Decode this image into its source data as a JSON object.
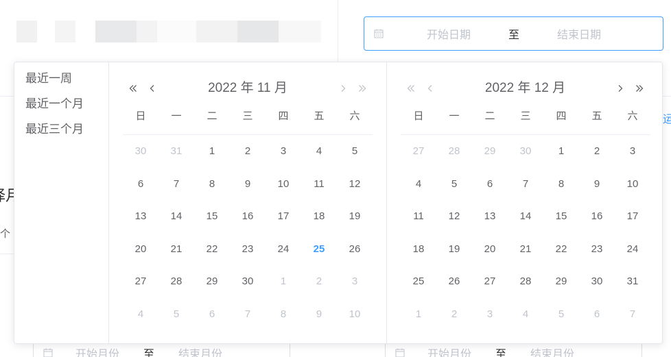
{
  "background": {
    "fragment_title": "择月",
    "fragment_text": "个",
    "fragment_link": "运"
  },
  "top_range": {
    "start_placeholder": "开始日期",
    "separator": "至",
    "end_placeholder": "结束日期"
  },
  "bottom_range_left": {
    "start_placeholder": "开始月份",
    "separator": "至",
    "end_placeholder": "结束月份"
  },
  "bottom_range_right": {
    "start_placeholder": "开始月份",
    "separator": "至",
    "end_placeholder": "结束月份"
  },
  "shortcuts": [
    "最近一周",
    "最近一个月",
    "最近三个月"
  ],
  "weekdays": [
    "日",
    "一",
    "二",
    "三",
    "四",
    "五",
    "六"
  ],
  "months": [
    {
      "title": "2022 年 11 月",
      "days": [
        {
          "d": "30",
          "o": true
        },
        {
          "d": "31",
          "o": true
        },
        {
          "d": "1"
        },
        {
          "d": "2"
        },
        {
          "d": "3"
        },
        {
          "d": "4"
        },
        {
          "d": "5"
        },
        {
          "d": "6"
        },
        {
          "d": "7"
        },
        {
          "d": "8"
        },
        {
          "d": "9"
        },
        {
          "d": "10"
        },
        {
          "d": "11"
        },
        {
          "d": "12"
        },
        {
          "d": "13"
        },
        {
          "d": "14"
        },
        {
          "d": "15"
        },
        {
          "d": "16"
        },
        {
          "d": "17"
        },
        {
          "d": "18"
        },
        {
          "d": "19"
        },
        {
          "d": "20"
        },
        {
          "d": "21"
        },
        {
          "d": "22"
        },
        {
          "d": "23"
        },
        {
          "d": "24"
        },
        {
          "d": "25",
          "t": true
        },
        {
          "d": "26"
        },
        {
          "d": "27"
        },
        {
          "d": "28"
        },
        {
          "d": "29"
        },
        {
          "d": "30"
        },
        {
          "d": "1",
          "o": true
        },
        {
          "d": "2",
          "o": true
        },
        {
          "d": "3",
          "o": true
        },
        {
          "d": "4",
          "o": true
        },
        {
          "d": "5",
          "o": true
        },
        {
          "d": "6",
          "o": true
        },
        {
          "d": "7",
          "o": true
        },
        {
          "d": "8",
          "o": true
        },
        {
          "d": "9",
          "o": true
        },
        {
          "d": "10",
          "o": true
        }
      ]
    },
    {
      "title": "2022 年 12 月",
      "days": [
        {
          "d": "27",
          "o": true
        },
        {
          "d": "28",
          "o": true
        },
        {
          "d": "29",
          "o": true
        },
        {
          "d": "30",
          "o": true
        },
        {
          "d": "1"
        },
        {
          "d": "2"
        },
        {
          "d": "3"
        },
        {
          "d": "4"
        },
        {
          "d": "5"
        },
        {
          "d": "6"
        },
        {
          "d": "7"
        },
        {
          "d": "8"
        },
        {
          "d": "9"
        },
        {
          "d": "10"
        },
        {
          "d": "11"
        },
        {
          "d": "12"
        },
        {
          "d": "13"
        },
        {
          "d": "14"
        },
        {
          "d": "15"
        },
        {
          "d": "16"
        },
        {
          "d": "17"
        },
        {
          "d": "18"
        },
        {
          "d": "19"
        },
        {
          "d": "20"
        },
        {
          "d": "21"
        },
        {
          "d": "22"
        },
        {
          "d": "23"
        },
        {
          "d": "24"
        },
        {
          "d": "25"
        },
        {
          "d": "26"
        },
        {
          "d": "27"
        },
        {
          "d": "28"
        },
        {
          "d": "29"
        },
        {
          "d": "30"
        },
        {
          "d": "31"
        },
        {
          "d": "1",
          "o": true
        },
        {
          "d": "2",
          "o": true
        },
        {
          "d": "3",
          "o": true
        },
        {
          "d": "4",
          "o": true
        },
        {
          "d": "5",
          "o": true
        },
        {
          "d": "6",
          "o": true
        },
        {
          "d": "7",
          "o": true
        }
      ]
    }
  ],
  "colors": {
    "accent": "#409eff",
    "text": "#606266",
    "muted": "#c0c4cc",
    "border": "#e4e7ed"
  },
  "icons": {
    "input": "calendar-icon",
    "prev_year": "double-chevron-left-icon",
    "prev_month": "chevron-left-icon",
    "next_month": "chevron-right-icon",
    "next_year": "double-chevron-right-icon"
  }
}
